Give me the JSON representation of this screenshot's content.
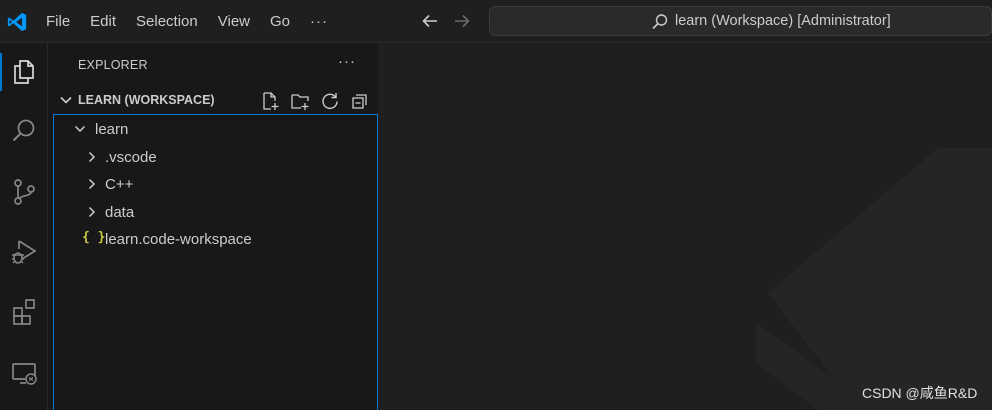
{
  "titlebar": {
    "menu": [
      "File",
      "Edit",
      "Selection",
      "View",
      "Go"
    ],
    "menu_more": "···",
    "command_center": "learn (Workspace) [Administrator]"
  },
  "activitybar": {
    "items": [
      "explorer",
      "search",
      "source-control",
      "run-and-debug",
      "extensions",
      "remote-explorer"
    ]
  },
  "sidebar": {
    "title": "EXPLORER",
    "more": "···",
    "section_title": "LEARN (WORKSPACE)",
    "tree": [
      {
        "label": "learn",
        "type": "folder",
        "expanded": true,
        "depth": 0
      },
      {
        "label": ".vscode",
        "type": "folder",
        "expanded": false,
        "depth": 1
      },
      {
        "label": "C++",
        "type": "folder",
        "expanded": false,
        "depth": 1
      },
      {
        "label": "data",
        "type": "folder",
        "expanded": false,
        "depth": 1
      },
      {
        "label": "learn.code-workspace",
        "type": "file",
        "icon": "{ }",
        "depth": 1
      }
    ]
  },
  "watermark": "CSDN @咸鱼R&D",
  "colors": {
    "accent": "#0078d4",
    "json_icon": "#cbcb41",
    "logo": "#0098ff"
  }
}
